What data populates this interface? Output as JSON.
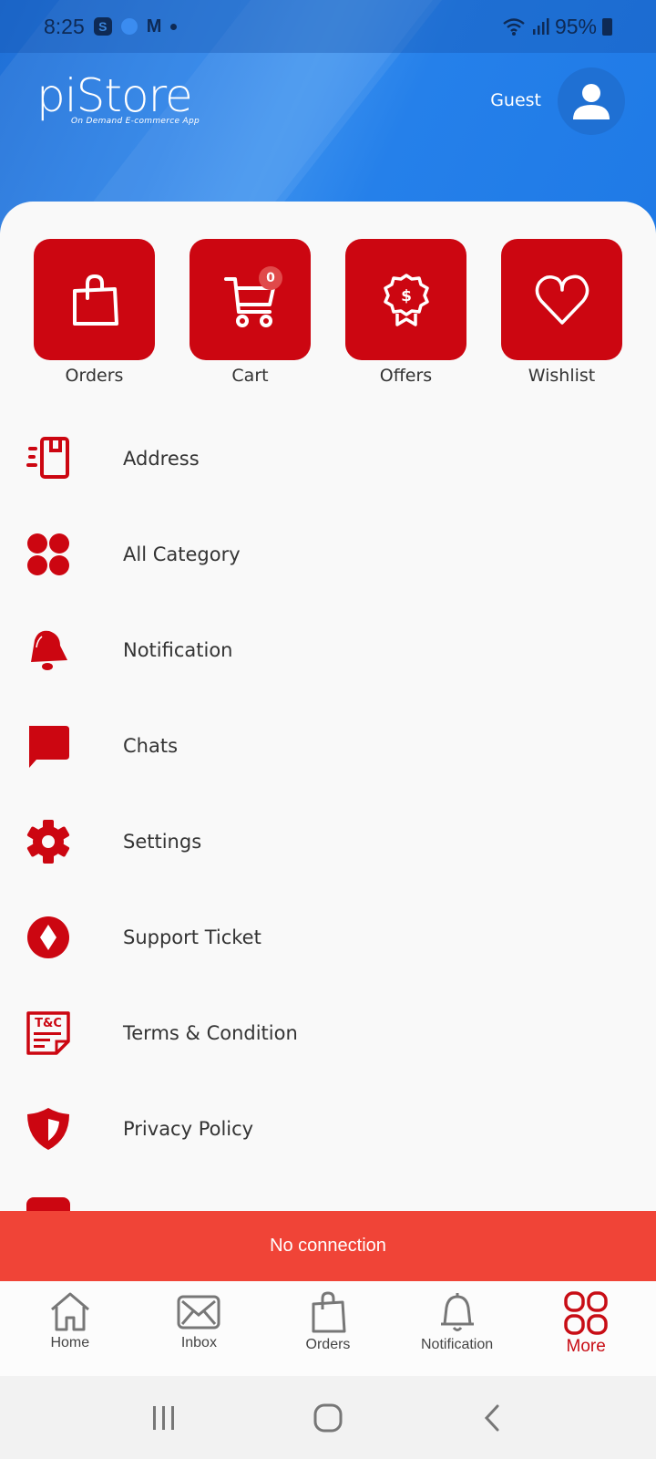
{
  "status_bar": {
    "time": "8:25",
    "battery": "95%",
    "notification_icons": [
      "skype-icon",
      "blue-dot-icon",
      "gmail-icon",
      "more-dot-icon"
    ]
  },
  "header": {
    "logo_text": "piStore",
    "logo_tagline": "On Demand E-commerce App",
    "user_name": "Guest"
  },
  "quick_actions": [
    {
      "label": "Orders",
      "icon": "shopping-bag-icon"
    },
    {
      "label": "Cart",
      "icon": "cart-icon",
      "badge": "0"
    },
    {
      "label": "Offers",
      "icon": "offer-badge-icon"
    },
    {
      "label": "Wishlist",
      "icon": "heart-icon"
    }
  ],
  "menu": [
    {
      "label": "Address",
      "icon": "address-icon"
    },
    {
      "label": "All Category",
      "icon": "category-icon"
    },
    {
      "label": "Notification",
      "icon": "bell-icon"
    },
    {
      "label": "Chats",
      "icon": "chat-icon"
    },
    {
      "label": "Settings",
      "icon": "gear-icon"
    },
    {
      "label": "Support Ticket",
      "icon": "support-ticket-icon"
    },
    {
      "label": "Terms & Condition",
      "icon": "terms-icon"
    },
    {
      "label": "Privacy Policy",
      "icon": "shield-icon"
    }
  ],
  "snackbar": {
    "message": "No connection"
  },
  "bottom_nav": [
    {
      "label": "Home",
      "icon": "home-icon",
      "active": false
    },
    {
      "label": "Inbox",
      "icon": "inbox-icon",
      "active": false
    },
    {
      "label": "Orders",
      "icon": "shopping-bag-icon",
      "active": false
    },
    {
      "label": "Notification",
      "icon": "bell-icon",
      "active": false
    },
    {
      "label": "More",
      "icon": "more-grid-icon",
      "active": true
    }
  ],
  "colors": {
    "brand_red": "#cc0611",
    "header_blue": "#2580ea",
    "snackbar_red": "#f04437",
    "active_nav": "#c80d15"
  }
}
